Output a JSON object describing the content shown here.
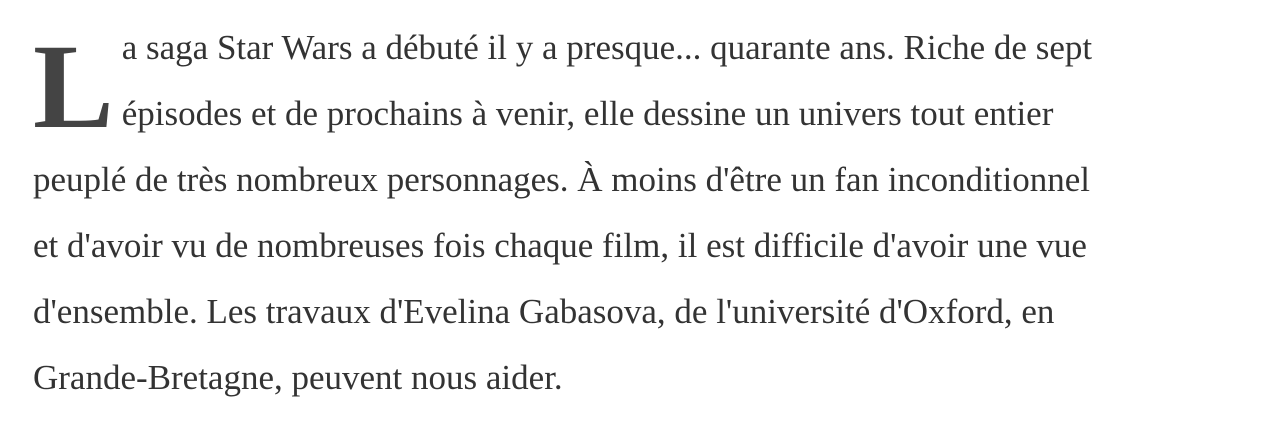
{
  "article": {
    "drop_cap": "L",
    "lines": [
      "a saga Star Wars a débuté il y a presque... quarante ans. Riche de sept",
      "épisodes et de prochains à venir, elle dessine un univers tout entier",
      "peuplé de très nombreux personnages. À moins d'être un fan inconditionnel",
      "et d'avoir vu de nombreuses fois chaque film, il est difficile d'avoir une vue",
      "d'ensemble. Les travaux d'Evelina Gabasova, de l'université d'Oxford, en",
      "Grande-Bretagne, peuvent nous aider."
    ],
    "text_color": "#333333",
    "drop_cap_color": "#444444"
  }
}
